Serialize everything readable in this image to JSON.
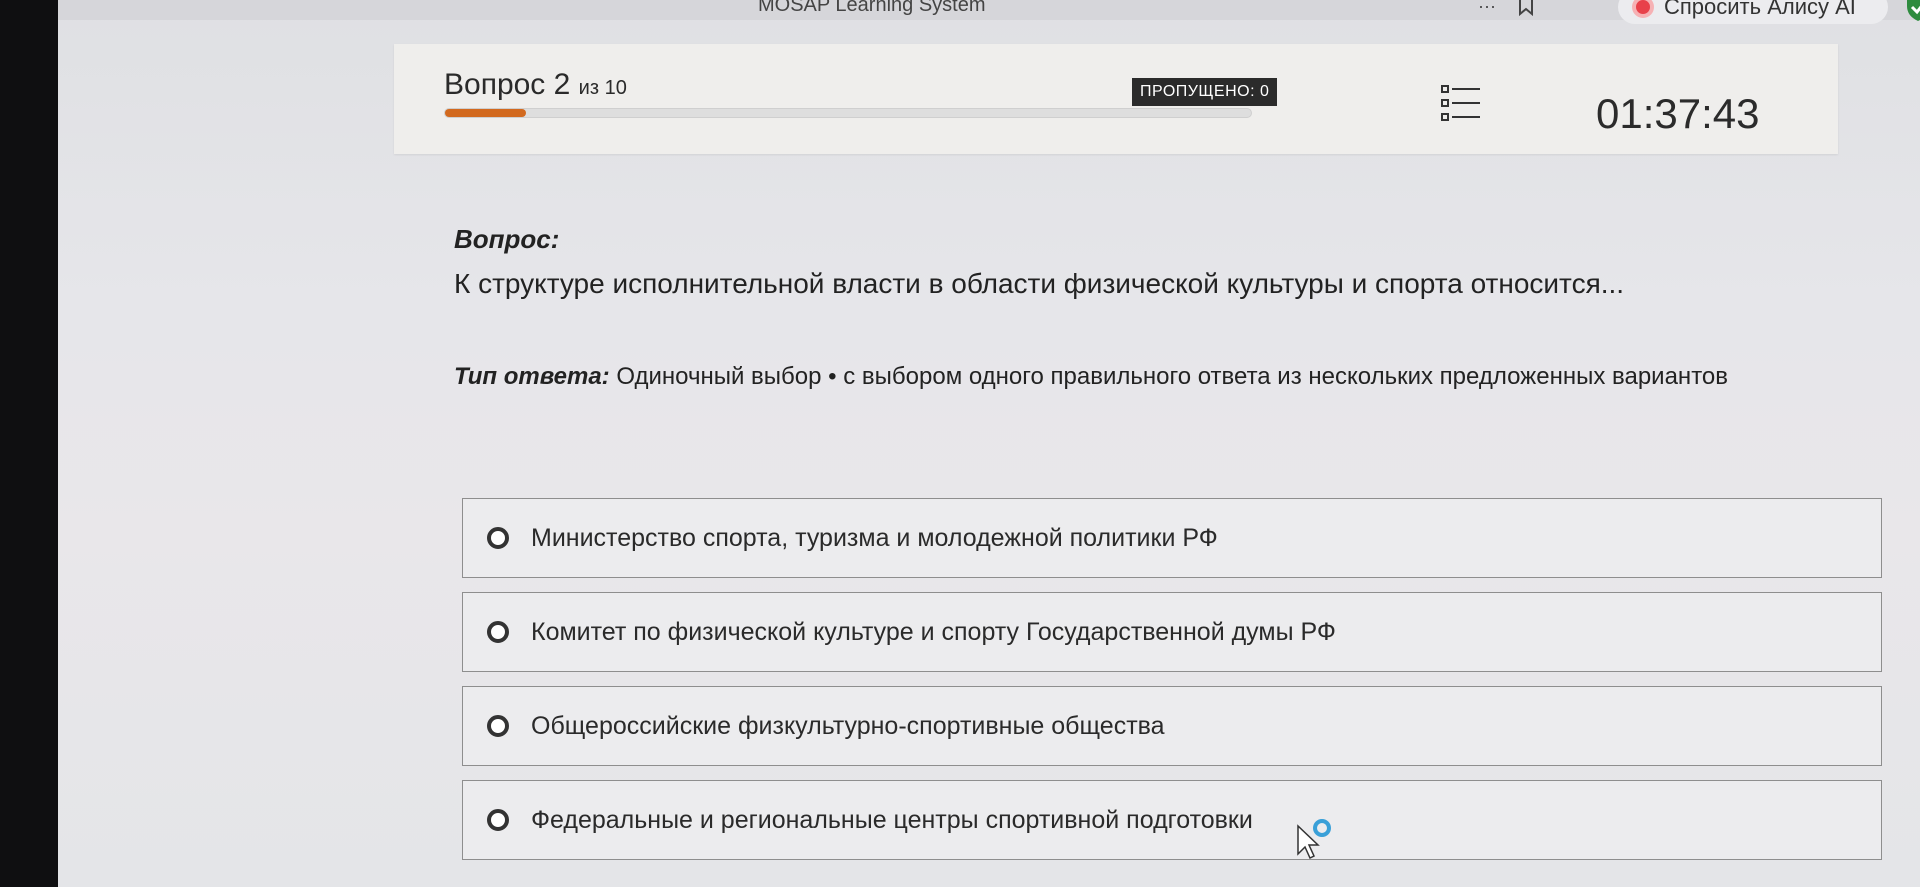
{
  "browser": {
    "title": "MOSAP Learning System",
    "menu_dots": "···",
    "alice_button_label": "Спросить Алису AI"
  },
  "header": {
    "question_label": "Вопрос 2",
    "question_of": "из 10",
    "progress_fraction": 0.1,
    "skipped_badge": "ПРОПУЩЕНО: 0",
    "timer": "01:37:43"
  },
  "question": {
    "heading": "Вопрос:",
    "text": "К структуре исполнительной власти в области физической культуры и спорта относится...",
    "answer_type_label": "Тип ответа:",
    "answer_type_value": "Одиночный выбор • с выбором одного правильного ответа из нескольких предложенных вариантов"
  },
  "options": [
    {
      "label": "Министерство спорта, туризма и молодежной политики РФ"
    },
    {
      "label": "Комитет по физической культуре и спорту Государственной думы РФ"
    },
    {
      "label": "Общероссийские физкультурно-спортивные общества"
    },
    {
      "label": "Федеральные и региональные центры спортивной подготовки"
    }
  ],
  "colors": {
    "progress": "#d2691e",
    "badge_bg": "#2b2b2b",
    "alice_accent": "#e8414a",
    "shield": "#2e8b3e"
  },
  "icons": [
    "bookmark-icon",
    "alice-icon",
    "shield-icon",
    "question-list-icon",
    "radio-icon",
    "cursor-icon"
  ]
}
